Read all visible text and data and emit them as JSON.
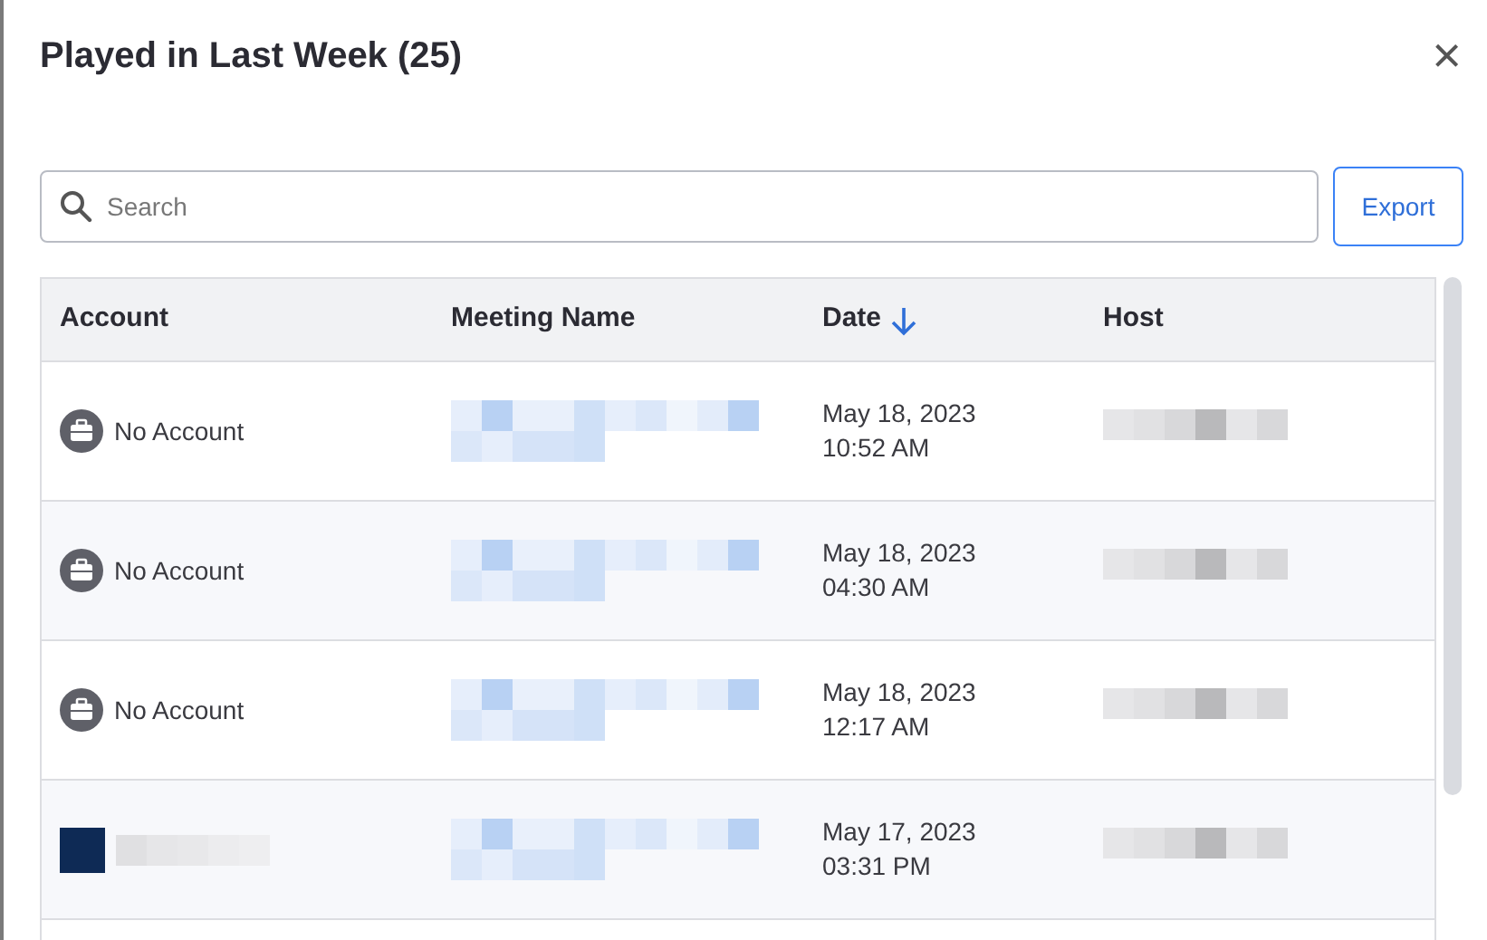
{
  "dialog": {
    "title": "Played in Last Week (25)",
    "close": "×"
  },
  "search": {
    "placeholder": "Search"
  },
  "export_button": "Export",
  "table": {
    "columns": [
      {
        "label": "Account",
        "sorted": false
      },
      {
        "label": "Meeting Name",
        "sorted": false
      },
      {
        "label": "Date",
        "sorted": true
      },
      {
        "label": "Host",
        "sorted": false
      }
    ],
    "rows": [
      {
        "kind": "none",
        "account": "No Account",
        "date": "May 18, 2023",
        "time": "10:52 AM"
      },
      {
        "kind": "none",
        "account": "No Account",
        "date": "May 18, 2023",
        "time": "04:30 AM"
      },
      {
        "kind": "none",
        "account": "No Account",
        "date": "May 18, 2023",
        "time": "12:17 AM"
      },
      {
        "kind": "logo",
        "date": "May 17, 2023",
        "time": "03:31 PM"
      }
    ]
  }
}
